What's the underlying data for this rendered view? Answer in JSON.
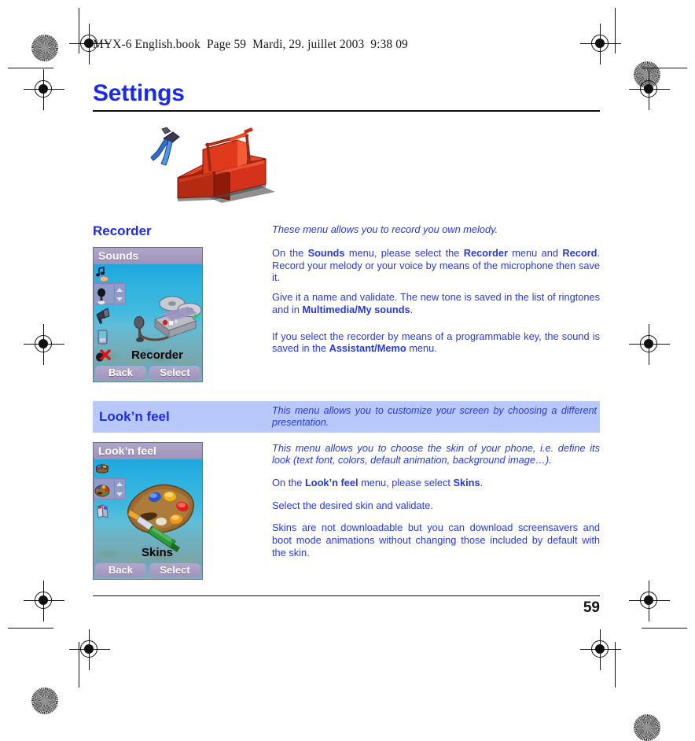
{
  "document": {
    "file_header": "MYX-6 English.book  Page 59  Mardi, 29. juillet 2003  9:38 09",
    "title": "Settings",
    "page_number": "59"
  },
  "illustration": {
    "name": "toolbox-pliers-illustration",
    "alt": "Red toolbox with blue pliers"
  },
  "sections": [
    {
      "id": "recorder",
      "heading": "Recorder",
      "intro": "These menu allows you to record you own melody.",
      "screen": {
        "title": "Sounds",
        "caption": "Recorder",
        "softkey_left": "Back",
        "softkey_right": "Select"
      },
      "paragraphs": [
        "On the Sounds menu, please select the Recorder menu and Record. Record your melody or your voice by means of the microphone then save it.",
        "Give it a name and validate. The new tone is saved in the list of ringtones and in Multimedia/My sounds.",
        "If you select the recorder by means of a programmable key, the sound is saved in the Assistant/Memo menu."
      ]
    },
    {
      "id": "looknfeel",
      "heading": "Look’n feel",
      "band_desc": "This menu allows you to customize your screen by choosing a different presentation.",
      "screen": {
        "title": "Look’n feel",
        "caption": "Skins",
        "softkey_left": "Back",
        "softkey_right": "Select"
      },
      "paragraphs": [
        "This menu allows you to choose the skin of your phone, i.e. define its look (text font, colors, default animation, background image…).",
        "On the Look’n feel menu, please select Skins.",
        "Select the desired skin and validate.",
        "Skins are not downloadable but you can download screensavers and boot mode animations without changing those included by default with the skin."
      ]
    }
  ],
  "colors": {
    "body_text_blue": "#2438e8",
    "heading_blue": "#1b2ae6",
    "band_background": "#b9c8fa",
    "phone_title_bar": "#9d92bb",
    "phone_background": "#2fb3df",
    "softkey": "#a89ec4"
  }
}
